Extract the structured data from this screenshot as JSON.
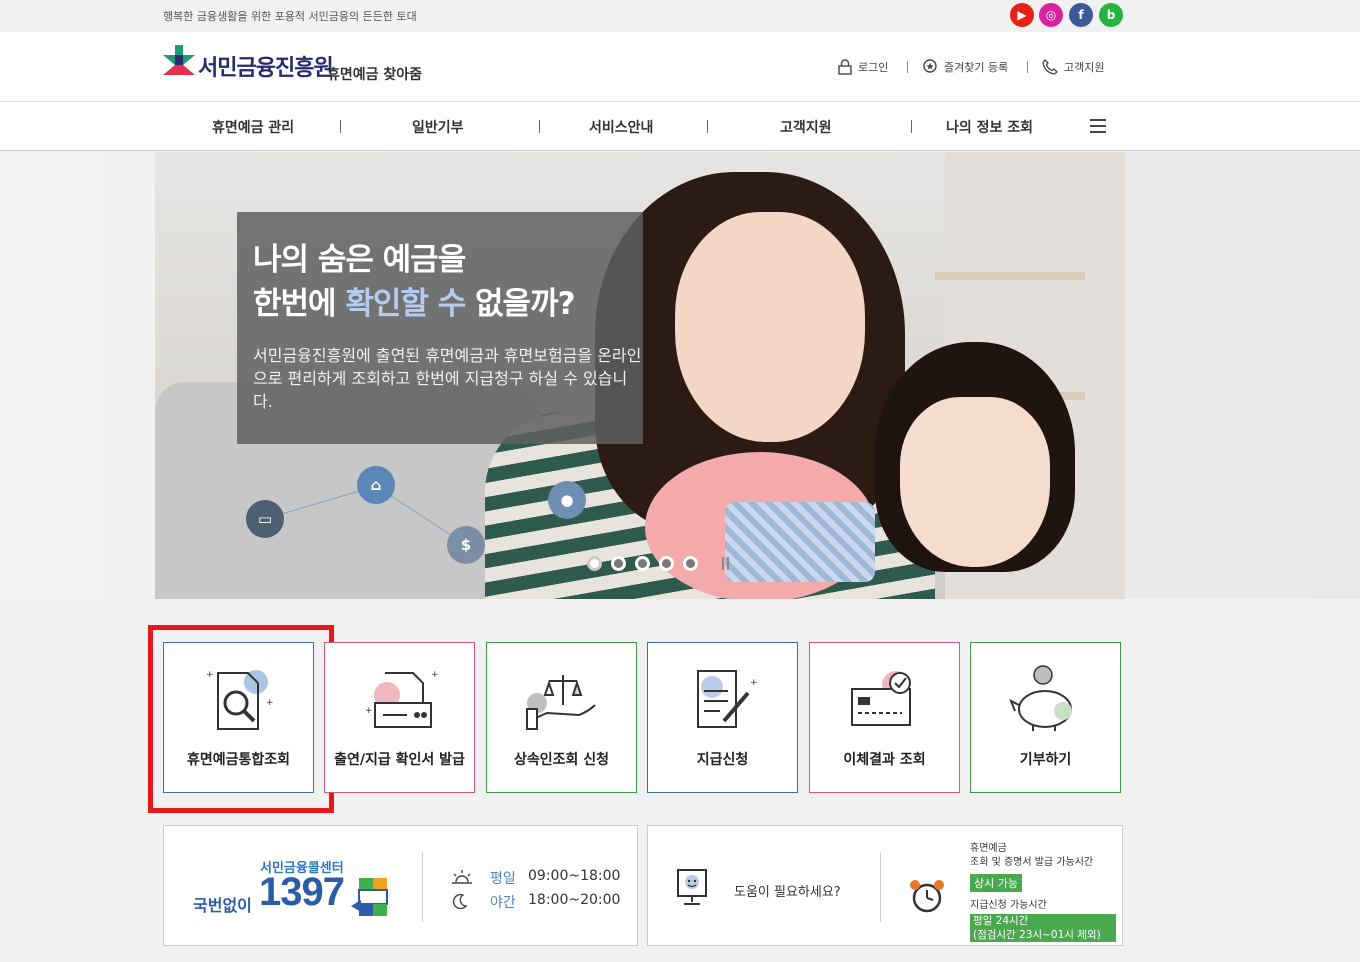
{
  "topbar": {
    "tagline": "행복한 금융생활을 위한 포용적 서민금융의 든든한 토대",
    "social": [
      {
        "name": "youtube-icon",
        "glyph": "▶",
        "color": "#e62117"
      },
      {
        "name": "instagram-icon",
        "glyph": "◎",
        "color": "#d6249f"
      },
      {
        "name": "facebook-icon",
        "glyph": "f",
        "color": "#3b5998"
      },
      {
        "name": "blog-icon",
        "glyph": "b",
        "color": "#27b43e"
      }
    ]
  },
  "header": {
    "logo_main": "서민금융진흥원",
    "logo_sub": "휴면예금 찾아줌",
    "utils": {
      "login": "로그인",
      "favorite": "즐겨찾기 등록",
      "support": "고객지원"
    }
  },
  "gnb": {
    "items": [
      "휴면예금 관리",
      "일반기부",
      "서비스안내",
      "고객지원",
      "나의 정보 조회"
    ]
  },
  "hero": {
    "title_line1": "나의 숨은 예금을",
    "title_line2_a": "한번에 ",
    "title_line2_hl": "확인할 수",
    "title_line2_b": " 없을까?",
    "desc": "서민금융진흥원에 출연된 휴면예금과 휴면보험금을 온라인으로 편리하게 조회하고 한번에 지급청구 하실 수 있습니다.",
    "slide_count": 5,
    "active_slide": 1
  },
  "cards": [
    {
      "label": "휴면예금통합조회",
      "border": "#3d6fa8"
    },
    {
      "label": "출연/지급 확인서 발급",
      "border": "#d4587e"
    },
    {
      "label": "상속인조회 신청",
      "border": "#3f9a4b"
    },
    {
      "label": "지급신청",
      "border": "#3d6fa8"
    },
    {
      "label": "이체결과 조회",
      "border": "#d4587e"
    },
    {
      "label": "기부하기",
      "border": "#3f9a4b"
    }
  ],
  "callcenter": {
    "title": "서민금융콜센터",
    "prefix": "국번없이",
    "number": "1397",
    "weekday_label": "평일",
    "weekday_time": "09:00~18:00",
    "night_label": "야간",
    "night_time": "18:00~20:00"
  },
  "help": {
    "text": "도움이 필요하세요?",
    "line1": "휴면예금",
    "line2": "조회 및 증명서 발급 가능시간",
    "badge1": "상시 가능",
    "line3": "지급신청 가능시간",
    "badge2_a": "평일 24시간",
    "badge2_b": "(점검시간 23시~01시 제외)"
  }
}
